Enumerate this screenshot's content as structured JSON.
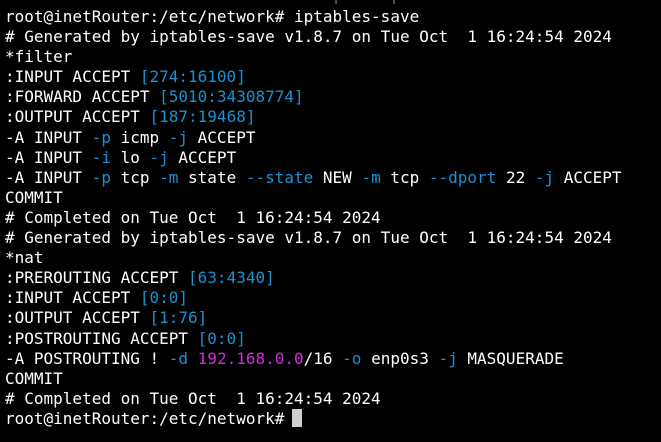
{
  "top_fragment": "` | ` ` | `",
  "lines": [
    {
      "name": "prompt-line-command",
      "segments": [
        {
          "text": "root@inetRouter:/etc/network# ",
          "color": "white"
        },
        {
          "text": "iptables-save",
          "color": "white"
        }
      ]
    },
    {
      "name": "comment-generated-filter",
      "segments": [
        {
          "text": "# Generated by iptables-save v1.8.7 on Tue Oct  1 16:24:54 2024",
          "color": "white"
        }
      ]
    },
    {
      "name": "filter-table-header",
      "segments": [
        {
          "text": "*filter",
          "color": "white"
        }
      ]
    },
    {
      "name": "chain-input-filter",
      "segments": [
        {
          "text": ":INPUT ACCEPT ",
          "color": "white"
        },
        {
          "text": "[274:16100]",
          "color": "blue"
        }
      ]
    },
    {
      "name": "chain-forward-filter",
      "segments": [
        {
          "text": ":FORWARD ACCEPT ",
          "color": "white"
        },
        {
          "text": "[5010:34308774]",
          "color": "blue"
        }
      ]
    },
    {
      "name": "chain-output-filter",
      "segments": [
        {
          "text": ":OUTPUT ACCEPT ",
          "color": "white"
        },
        {
          "text": "[187:19468]",
          "color": "blue"
        }
      ]
    },
    {
      "name": "rule-input-icmp",
      "segments": [
        {
          "text": "-A INPUT ",
          "color": "white"
        },
        {
          "text": "-p",
          "color": "blue"
        },
        {
          "text": " icmp ",
          "color": "white"
        },
        {
          "text": "-j",
          "color": "blue"
        },
        {
          "text": " ACCEPT",
          "color": "white"
        }
      ]
    },
    {
      "name": "rule-input-lo",
      "segments": [
        {
          "text": "-A INPUT ",
          "color": "white"
        },
        {
          "text": "-i",
          "color": "blue"
        },
        {
          "text": " lo ",
          "color": "white"
        },
        {
          "text": "-j",
          "color": "blue"
        },
        {
          "text": " ACCEPT",
          "color": "white"
        }
      ]
    },
    {
      "name": "rule-input-tcp-22",
      "segments": [
        {
          "text": "-A INPUT ",
          "color": "white"
        },
        {
          "text": "-p",
          "color": "blue"
        },
        {
          "text": " tcp ",
          "color": "white"
        },
        {
          "text": "-m",
          "color": "blue"
        },
        {
          "text": " state ",
          "color": "white"
        },
        {
          "text": "--state",
          "color": "blue"
        },
        {
          "text": " NEW ",
          "color": "white"
        },
        {
          "text": "-m",
          "color": "blue"
        },
        {
          "text": " tcp ",
          "color": "white"
        },
        {
          "text": "--dport",
          "color": "blue"
        },
        {
          "text": " 22 ",
          "color": "white"
        },
        {
          "text": "-j",
          "color": "blue"
        },
        {
          "text": " ACCEPT",
          "color": "white"
        }
      ]
    },
    {
      "name": "commit-filter",
      "segments": [
        {
          "text": "COMMIT",
          "color": "white"
        }
      ]
    },
    {
      "name": "comment-completed-filter",
      "segments": [
        {
          "text": "# Completed on Tue Oct  1 16:24:54 2024",
          "color": "white"
        }
      ]
    },
    {
      "name": "comment-generated-nat",
      "segments": [
        {
          "text": "# Generated by iptables-save v1.8.7 on Tue Oct  1 16:24:54 2024",
          "color": "white"
        }
      ]
    },
    {
      "name": "nat-table-header",
      "segments": [
        {
          "text": "*nat",
          "color": "white"
        }
      ]
    },
    {
      "name": "chain-prerouting-nat",
      "segments": [
        {
          "text": ":PREROUTING ACCEPT ",
          "color": "white"
        },
        {
          "text": "[63:4340]",
          "color": "blue"
        }
      ]
    },
    {
      "name": "chain-input-nat",
      "segments": [
        {
          "text": ":INPUT ACCEPT ",
          "color": "white"
        },
        {
          "text": "[0:0]",
          "color": "blue"
        }
      ]
    },
    {
      "name": "chain-output-nat",
      "segments": [
        {
          "text": ":OUTPUT ACCEPT ",
          "color": "white"
        },
        {
          "text": "[1:76]",
          "color": "blue"
        }
      ]
    },
    {
      "name": "chain-postrouting-nat",
      "segments": [
        {
          "text": ":POSTROUTING ACCEPT ",
          "color": "white"
        },
        {
          "text": "[0:0]",
          "color": "blue"
        }
      ]
    },
    {
      "name": "rule-postrouting-masquerade",
      "segments": [
        {
          "text": "-A POSTROUTING ! ",
          "color": "white"
        },
        {
          "text": "-d",
          "color": "blue"
        },
        {
          "text": " ",
          "color": "white"
        },
        {
          "text": "192.168.0.0",
          "color": "magenta"
        },
        {
          "text": "/16 ",
          "color": "white"
        },
        {
          "text": "-o",
          "color": "blue"
        },
        {
          "text": " enp0s3 ",
          "color": "white"
        },
        {
          "text": "-j",
          "color": "blue"
        },
        {
          "text": " MASQUERADE",
          "color": "white"
        }
      ]
    },
    {
      "name": "commit-nat",
      "segments": [
        {
          "text": "COMMIT",
          "color": "white"
        }
      ]
    },
    {
      "name": "comment-completed-nat",
      "segments": [
        {
          "text": "# Completed on Tue Oct  1 16:24:54 2024",
          "color": "white"
        }
      ]
    },
    {
      "name": "prompt-line-current",
      "segments": [
        {
          "text": "root@inetRouter:/etc/network#",
          "color": "white"
        }
      ],
      "cursor": true
    }
  ],
  "colors": {
    "background": "#000000",
    "white": "#ffffff",
    "blue": "#1a91d1",
    "magenta": "#d42bd8",
    "cursor": "#cfcfcf"
  }
}
